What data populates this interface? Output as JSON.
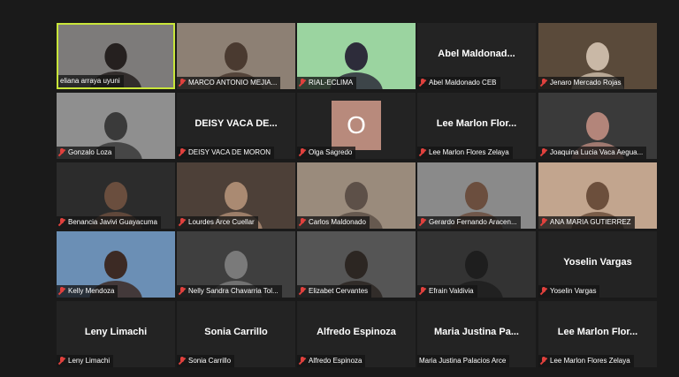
{
  "participants": [
    {
      "name": "eliana arraya uyuni",
      "muted": false,
      "video": true,
      "active": true,
      "bg": "#7d7b7a",
      "fg": "#25201f"
    },
    {
      "name": "MARCO ANTONIO MEJIA...",
      "muted": true,
      "video": true,
      "bg": "#8d8074",
      "fg": "#4a3a30"
    },
    {
      "name": "RIAL-ECLIMA",
      "muted": true,
      "video": true,
      "bg": "#9bd4a0",
      "fg": "#2d2c3a"
    },
    {
      "name": "Abel Maldonado CEB",
      "muted": true,
      "video": false,
      "display": "Abel Maldonad..."
    },
    {
      "name": "Jenaro Mercado Rojas",
      "muted": true,
      "video": true,
      "bg": "#5a4a3a",
      "fg": "#c9b8a6"
    },
    {
      "name": "Gonzalo Loza",
      "muted": true,
      "video": true,
      "bg": "#8f8f8f",
      "fg": "#3a3a3a"
    },
    {
      "name": "DEISY VACA DE MORON",
      "muted": true,
      "video": false,
      "display": "DEISY VACA DE..."
    },
    {
      "name": "Olga Sagredo",
      "muted": true,
      "video": false,
      "avatar": "O"
    },
    {
      "name": "Lee Marlon Flores Zelaya",
      "muted": true,
      "video": false,
      "display": "Lee Marlon Flor..."
    },
    {
      "name": "Joaquina Lucia Vaca Aegua...",
      "muted": true,
      "video": true,
      "bg": "#3a3a3a",
      "fg": "#b3857a"
    },
    {
      "name": "Benancia Javivi Guayacuma",
      "muted": true,
      "video": true,
      "bg": "#2c2c2c",
      "fg": "#6a4e3e"
    },
    {
      "name": "Lourdes Arce Cuellar",
      "muted": true,
      "video": true,
      "bg": "#4d4038",
      "fg": "#aa8a72"
    },
    {
      "name": "Carlos Maldonado",
      "muted": true,
      "video": true,
      "bg": "#9a8b7c",
      "fg": "#5d5048"
    },
    {
      "name": "Gerardo Fernando Aracen...",
      "muted": true,
      "video": true,
      "bg": "#8a8a8a",
      "fg": "#6b4e3e"
    },
    {
      "name": "ANA MARIA GUTIERREZ",
      "muted": true,
      "video": true,
      "bg": "#c2a58e",
      "fg": "#6c4f3c"
    },
    {
      "name": "Kelly Mendoza",
      "muted": true,
      "video": true,
      "bg": "#6b8fb5",
      "fg": "#3c2a24"
    },
    {
      "name": "Nelly Sandra Chavarria Tol...",
      "muted": true,
      "video": true,
      "bg": "#3f3f3f",
      "fg": "#7a7a7a"
    },
    {
      "name": "Elizabet Cervantes",
      "muted": true,
      "video": true,
      "bg": "#555555",
      "fg": "#2c2622"
    },
    {
      "name": "Efrain Valdivia",
      "muted": true,
      "video": true,
      "bg": "#333333",
      "fg": "#1e1e1e"
    },
    {
      "name": "Yoselin Vargas",
      "muted": true,
      "video": false,
      "display": "Yoselin Vargas"
    },
    {
      "name": "Leny Limachi",
      "muted": true,
      "video": false,
      "display": "Leny Limachi"
    },
    {
      "name": "Sonia Carrillo",
      "muted": true,
      "video": false,
      "display": "Sonia Carrillo"
    },
    {
      "name": "Alfredo Espinoza",
      "muted": true,
      "video": false,
      "display": "Alfredo Espinoza"
    },
    {
      "name": "Maria Justina Palacios Arce",
      "muted": false,
      "video": false,
      "display": "Maria Justina Pa..."
    },
    {
      "name": "Lee Marlon Flores Zelaya",
      "muted": true,
      "video": false,
      "display": "Lee Marlon Flor..."
    }
  ]
}
